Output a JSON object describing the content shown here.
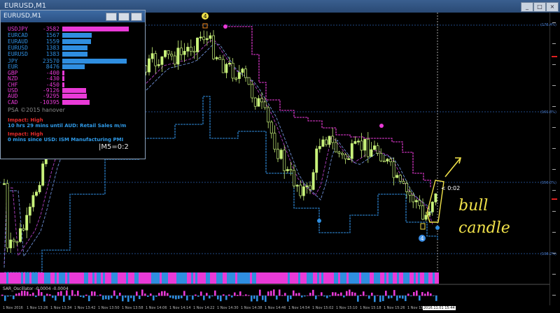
{
  "window": {
    "title": "EURUSD,M1",
    "controls": [
      "minimize",
      "maximize",
      "close"
    ]
  },
  "indicator_panel": {
    "title": "EURUSD,M1",
    "pairs": [
      {
        "name": "USDJPY",
        "value": "-3582",
        "color": "#e93ad7",
        "strength": 0.95
      },
      {
        "name": "EURCAD",
        "value": "1567",
        "color": "#2f8ee0",
        "strength": 0.42
      },
      {
        "name": "EURAUD",
        "value": "1559",
        "color": "#2f8ee0",
        "strength": 0.41
      },
      {
        "name": "EURUSD",
        "value": "1383",
        "color": "#2f8ee0",
        "strength": 0.36
      },
      {
        "name": "EURUSD",
        "value": "1383",
        "color": "#2f8ee0",
        "strength": 0.36
      }
    ],
    "currencies": [
      {
        "name": "JPY",
        "value": "23570",
        "color": "#2f8ee0",
        "strength": 0.97
      },
      {
        "name": "EUR",
        "value": "8476",
        "color": "#2f8ee0",
        "strength": 0.34
      },
      {
        "name": "GBP",
        "value": "-400",
        "color": "#e93ad7",
        "strength": 0.02
      },
      {
        "name": "NZD",
        "value": "-430",
        "color": "#e93ad7",
        "strength": 0.02
      },
      {
        "name": "CHF",
        "value": "-450",
        "color": "#e93ad7",
        "strength": 0.02
      },
      {
        "name": "USD",
        "value": "-9126",
        "color": "#e93ad7",
        "strength": 0.36
      },
      {
        "name": "AUD",
        "value": "-9295",
        "color": "#e93ad7",
        "strength": 0.37
      },
      {
        "name": "CAD",
        "value": "-10395",
        "color": "#e93ad7",
        "strength": 0.41
      }
    ],
    "copyright": "PSA ©2015 hanover",
    "news": [
      {
        "impact": "Impact: High",
        "text": "10 hrs 29 mins until AUD: Retail Sales m/m"
      },
      {
        "impact": "Impact: High",
        "text": "0 mins since USD: ISM Manufacturing PMI"
      }
    ],
    "m5_label": "|M5=0:2"
  },
  "chart": {
    "timer_label": "< 0:02",
    "marker_top": "4",
    "marker_bottom": "4",
    "fibo_labels": [
      "(176.4%)",
      "(161.8%)",
      "(150.0%)",
      "(138.2%)"
    ],
    "sub_indicator_title": "SAR_Oscillator -0.0004 -0.0004",
    "annotations": {
      "word1": "bull",
      "word2": "candle"
    },
    "colors": {
      "bull": "#c8f27a",
      "bear": "#000000",
      "sar": "#2f8ee0",
      "resistance": "#e93ad7",
      "mark": "#f0e14a"
    }
  },
  "time_axis": {
    "labels": [
      "1 Nov 2016",
      "1 Nov 13:26",
      "1 Nov 13:34",
      "1 Nov 13:42",
      "1 Nov 13:50",
      "1 Nov 13:58",
      "1 Nov 14:06",
      "1 Nov 14:14",
      "1 Nov 14:22",
      "1 Nov 14:30",
      "1 Nov 14:38",
      "1 Nov 14:46",
      "1 Nov 14:54",
      "1 Nov 15:02",
      "1 Nov 15:10",
      "1 Nov 15:18",
      "1 Nov 15:26",
      "1 Nov 15:34"
    ],
    "current": "2016.11.01 15:44"
  }
}
